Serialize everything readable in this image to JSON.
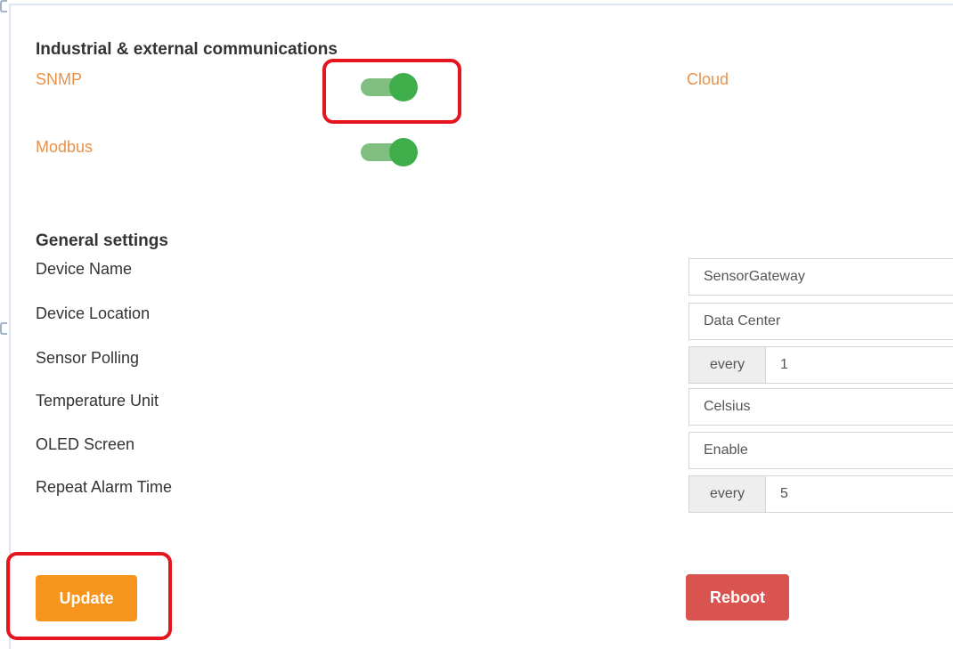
{
  "industrial": {
    "title": "Industrial & external communications",
    "snmp_label": "SNMP",
    "snmp_enabled": true,
    "cloud_label": "Cloud",
    "modbus_label": "Modbus",
    "modbus_enabled": true
  },
  "general": {
    "title": "General settings",
    "device_name": {
      "label": "Device Name",
      "value": "SensorGateway"
    },
    "device_location": {
      "label": "Device Location",
      "value": "Data Center"
    },
    "sensor_polling": {
      "label": "Sensor Polling",
      "prefix": "every",
      "value": "1"
    },
    "temperature_unit": {
      "label": "Temperature Unit",
      "value": "Celsius"
    },
    "oled_screen": {
      "label": "OLED Screen",
      "value": "Enable"
    },
    "repeat_alarm": {
      "label": "Repeat Alarm Time",
      "prefix": "every",
      "value": "5"
    }
  },
  "actions": {
    "update_label": "Update",
    "reboot_label": "Reboot"
  },
  "colors": {
    "accent_orange": "#e8914a",
    "toggle_on": "#3fae4a",
    "update_button": "#f7941d",
    "reboot_button": "#d9534f",
    "highlight_red": "#e5141d"
  }
}
